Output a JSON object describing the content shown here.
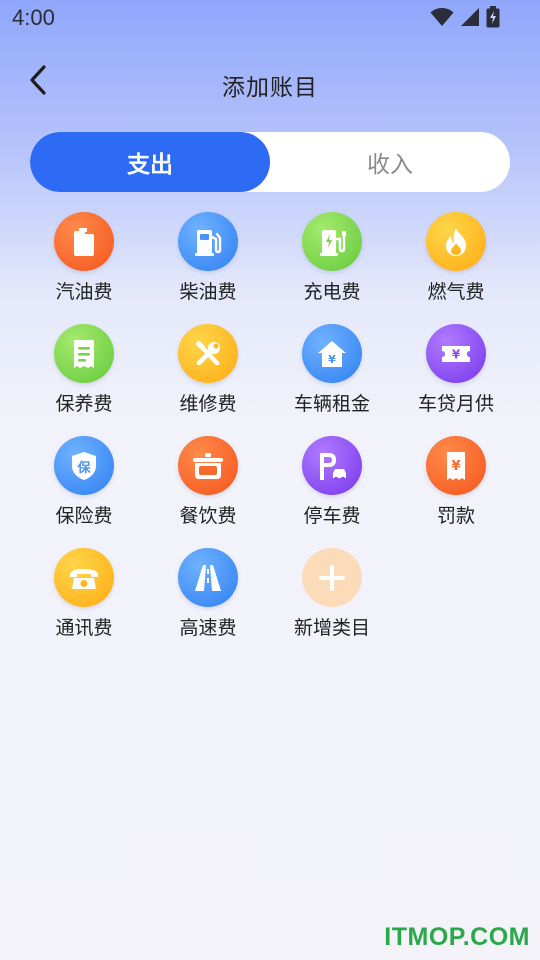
{
  "status_bar": {
    "time": "4:00"
  },
  "header": {
    "title": "添加账目"
  },
  "tabs": {
    "expense": "支出",
    "income": "收入",
    "selected": "expense"
  },
  "categories": [
    {
      "label": "汽油费",
      "icon": "fuel-can-icon",
      "color": "orange"
    },
    {
      "label": "柴油费",
      "icon": "fuel-pump-icon",
      "color": "blue"
    },
    {
      "label": "充电费",
      "icon": "charging-station-icon",
      "color": "green"
    },
    {
      "label": "燃气费",
      "icon": "flame-icon",
      "color": "yellow"
    },
    {
      "label": "保养费",
      "icon": "receipt-list-icon",
      "color": "green"
    },
    {
      "label": "维修费",
      "icon": "wrench-screwdriver-icon",
      "color": "yellow"
    },
    {
      "label": "车辆租金",
      "icon": "house-yuan-icon",
      "color": "blue"
    },
    {
      "label": "车贷月供",
      "icon": "yuan-ticket-icon",
      "color": "purple"
    },
    {
      "label": "保险费",
      "icon": "shield-bao-icon",
      "color": "blue"
    },
    {
      "label": "餐饮费",
      "icon": "cooking-pot-icon",
      "color": "orange"
    },
    {
      "label": "停车费",
      "icon": "parking-car-icon",
      "color": "purple"
    },
    {
      "label": "罚款",
      "icon": "yuan-receipt-icon",
      "color": "orange"
    },
    {
      "label": "通讯费",
      "icon": "telephone-icon",
      "color": "yellow"
    },
    {
      "label": "高速费",
      "icon": "highway-road-icon",
      "color": "blue"
    },
    {
      "label": "新增类目",
      "icon": "plus-icon",
      "color": "peach"
    }
  ],
  "icon_glyphs": {
    "shield_text": "保",
    "yuan": "¥"
  },
  "colors": {
    "accent": "#2e6bf5",
    "orange": "#f4551c",
    "blue": "#2f7ff2",
    "green": "#63c93a",
    "yellow": "#ffab12",
    "purple": "#7636ea",
    "peach": "#fcdcb8"
  },
  "watermark": "ITMOP.COM"
}
